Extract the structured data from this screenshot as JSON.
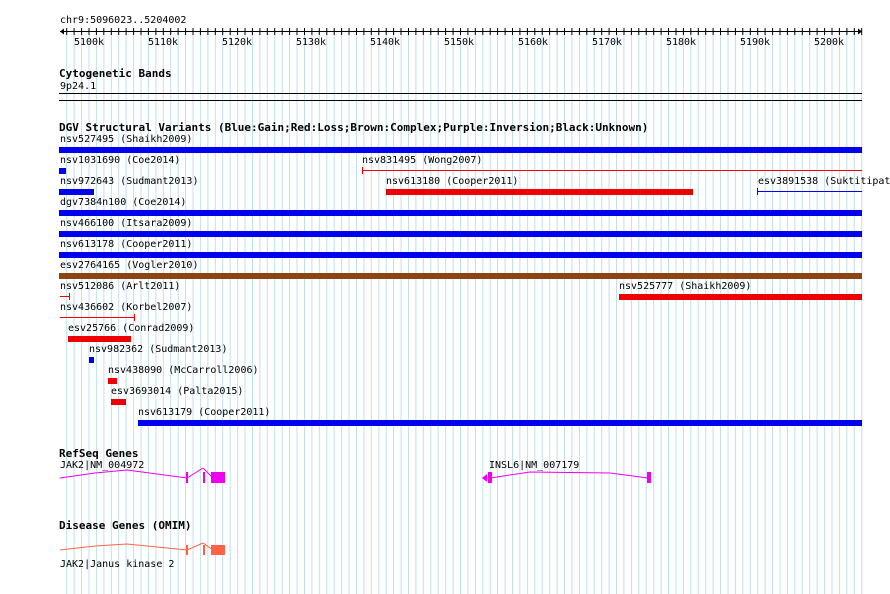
{
  "coords": "chr9:5096023..5204002",
  "ruler": {
    "ticks": [
      "5100k",
      "5110k",
      "5120k",
      "5130k",
      "5140k",
      "5150k",
      "5160k",
      "5170k",
      "5180k",
      "5190k",
      "5200k"
    ]
  },
  "colors": {
    "gain": "#0000ee",
    "loss": "#ee0000",
    "complex": "#8b4513",
    "gene": "#ee00ee",
    "omim": "#ff6347",
    "grid": "#bfe0ee"
  },
  "cyto": {
    "title": "Cytogenetic Bands",
    "band": "9p24.1"
  },
  "dgv": {
    "title": "DGV Structural Variants (Blue:Gain;Red:Loss;Brown:Complex;Purple:Inversion;Black:Unknown)",
    "variants": [
      {
        "label": "nsv527495 (Shaikh2009)",
        "type": "gain"
      },
      {
        "label": "nsv1031690 (Coe2014)",
        "type": "gain"
      },
      {
        "label": "nsv831495 (Wong2007)",
        "type": "loss"
      },
      {
        "label": "nsv972643 (Sudmant2013)",
        "type": "gain"
      },
      {
        "label": "nsv613180 (Cooper2011)",
        "type": "loss"
      },
      {
        "label": "esv3891538 (Suktitipat",
        "type": "gain"
      },
      {
        "label": "dgv7384n100 (Coe2014)",
        "type": "gain"
      },
      {
        "label": "nsv466100 (Itsara2009)",
        "type": "gain"
      },
      {
        "label": "nsv613178 (Cooper2011)",
        "type": "gain"
      },
      {
        "label": "esv2764165 (Vogler2010)",
        "type": "complex"
      },
      {
        "label": "nsv512086 (Arlt2011)",
        "type": "loss"
      },
      {
        "label": "nsv525777 (Shaikh2009)",
        "type": "loss"
      },
      {
        "label": "nsv436602 (Korbel2007)",
        "type": "loss"
      },
      {
        "label": "esv25766 (Conrad2009)",
        "type": "loss"
      },
      {
        "label": "nsv982362 (Sudmant2013)",
        "type": "gain"
      },
      {
        "label": "nsv438090 (McCarroll2006)",
        "type": "loss"
      },
      {
        "label": "esv3693014 (Palta2015)",
        "type": "loss"
      },
      {
        "label": "nsv613179 (Cooper2011)",
        "type": "gain"
      }
    ]
  },
  "refseq": {
    "title": "RefSeq Genes",
    "genes": [
      "JAK2|NM_004972",
      "INSL6|NM_007179"
    ]
  },
  "omim": {
    "title": "Disease Genes (OMIM)",
    "gene": "JAK2|Janus kinase 2"
  }
}
